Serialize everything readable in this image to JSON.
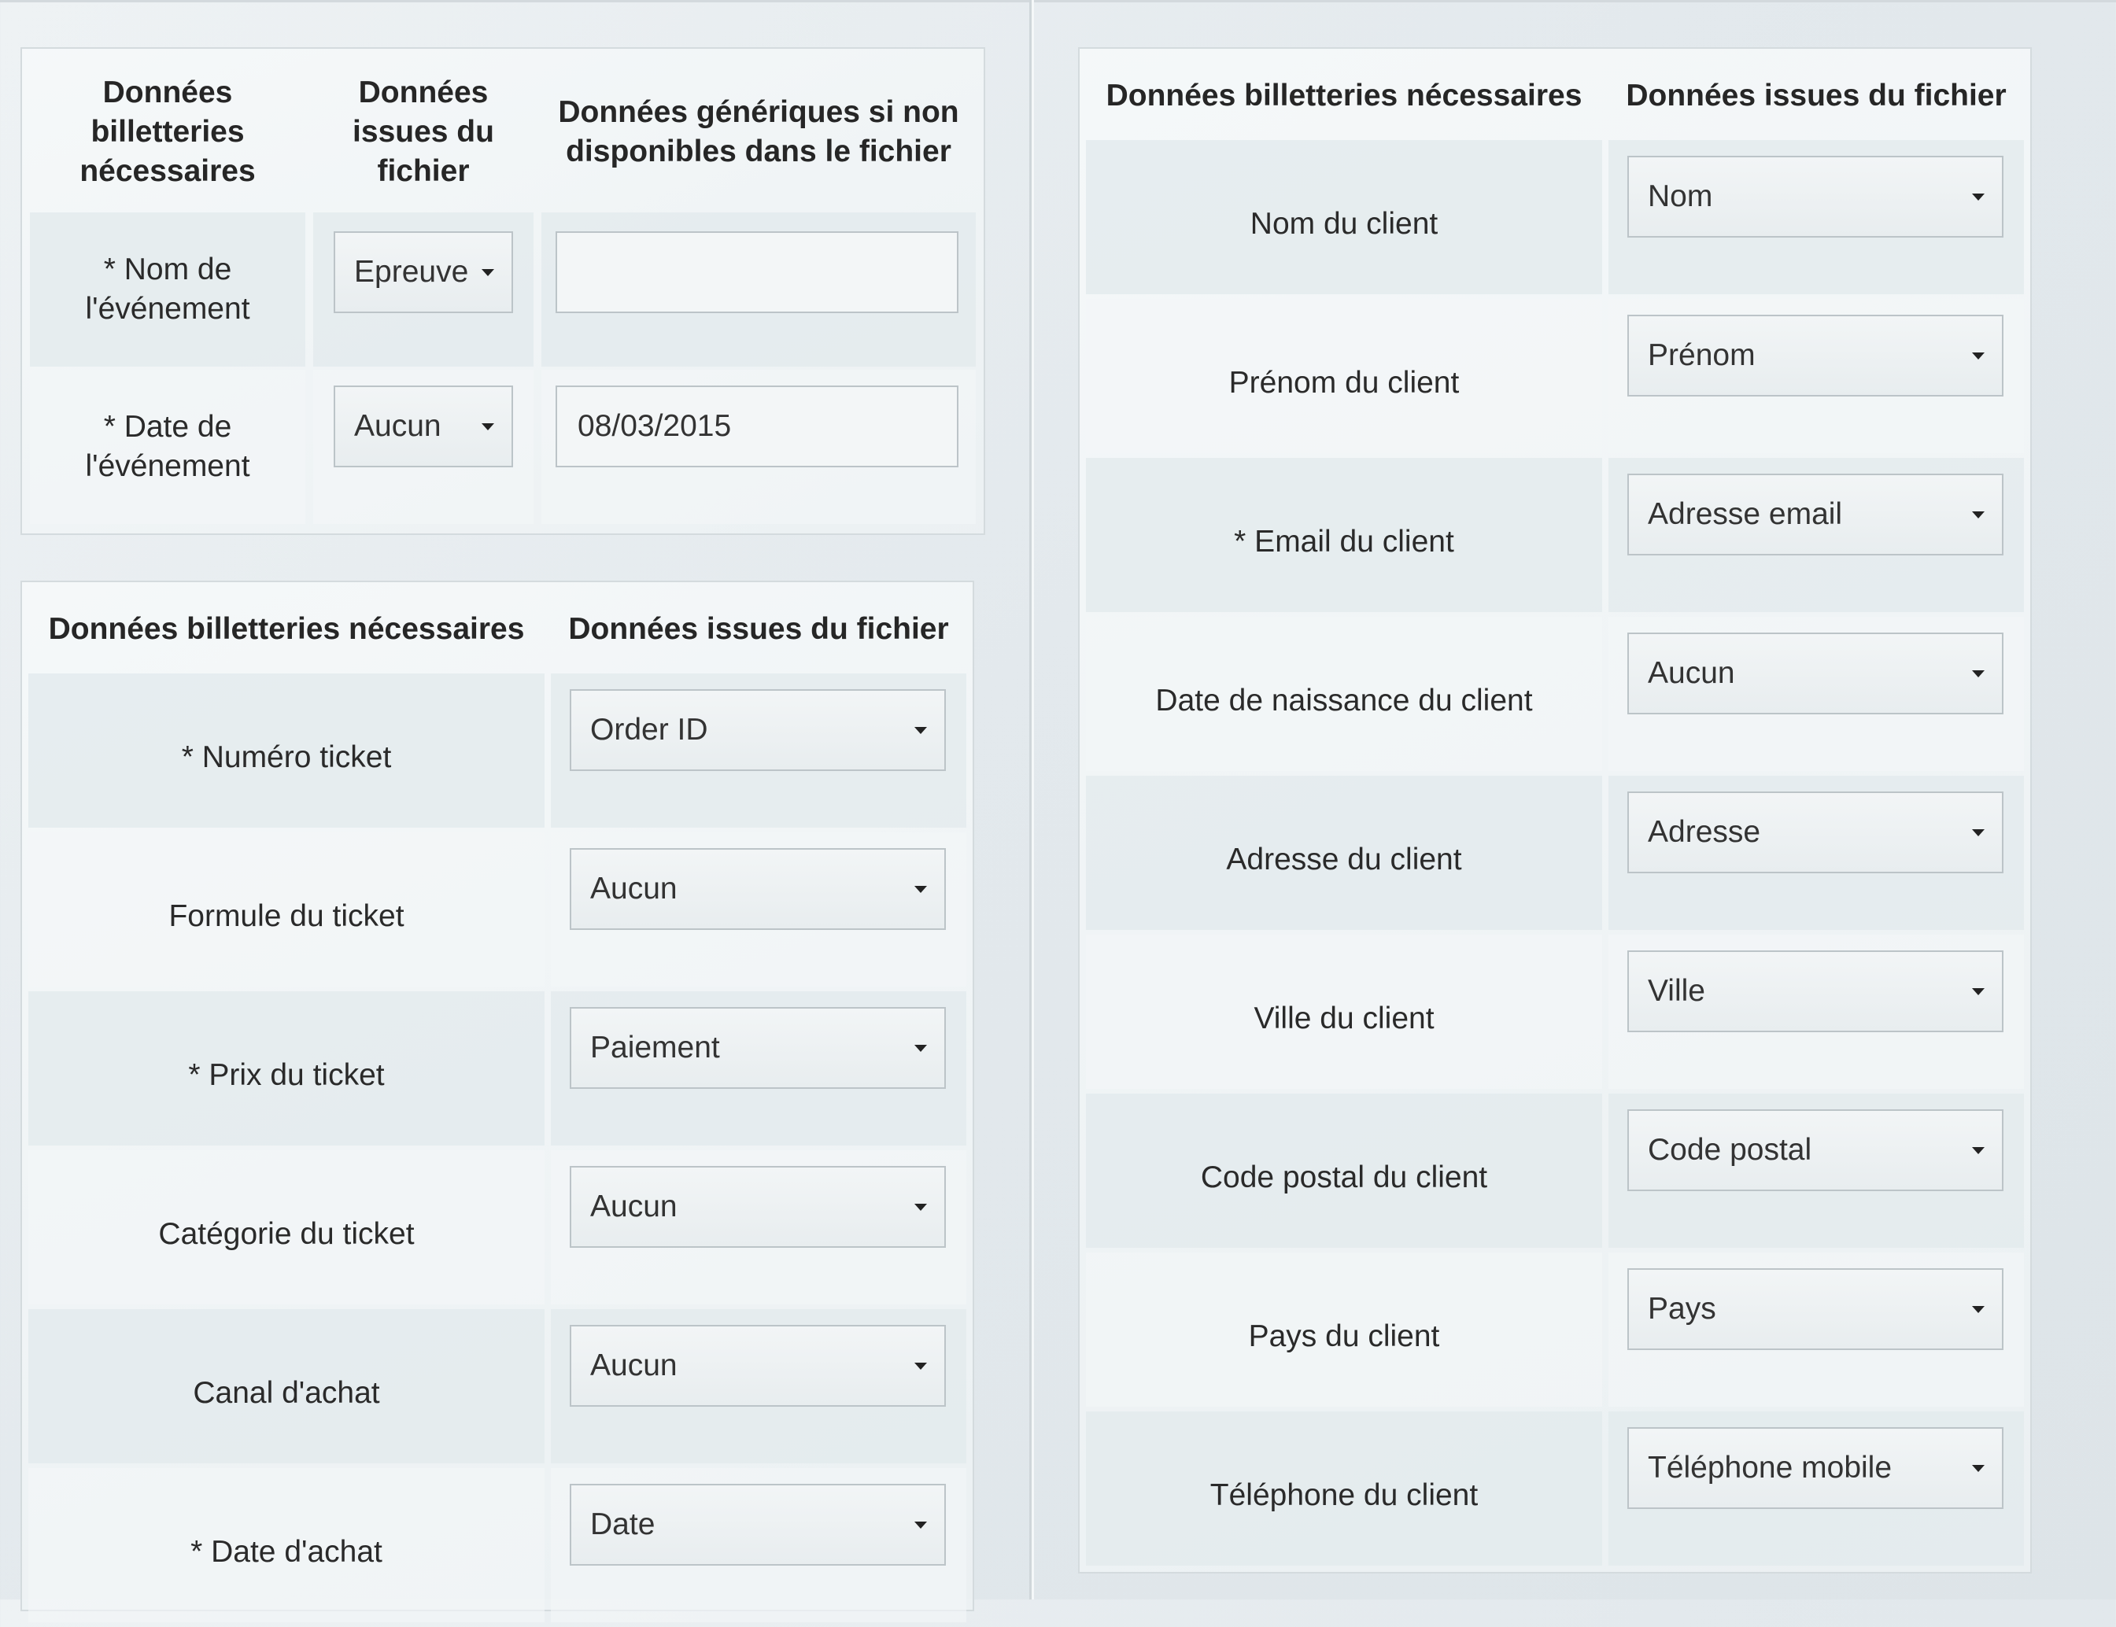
{
  "event_panel": {
    "headers": [
      "Données billetteries nécessaires",
      "Données issues du fichier",
      "Données génériques si non disponibles dans le fichier"
    ],
    "rows": [
      {
        "label": "* Nom de l'événement",
        "select": "Epreuve",
        "generic": "",
        "generic_placeholder": ""
      },
      {
        "label": "* Date de l'événement",
        "select": "Aucun",
        "generic": "08/03/2015",
        "generic_placeholder": ""
      }
    ]
  },
  "ticket_panel": {
    "headers": [
      "Données billetteries nécessaires",
      "Données issues du fichier"
    ],
    "rows": [
      {
        "label": "* Numéro ticket",
        "select": "Order ID"
      },
      {
        "label": "Formule du ticket",
        "select": "Aucun"
      },
      {
        "label": "* Prix du ticket",
        "select": "Paiement"
      },
      {
        "label": "Catégorie du ticket",
        "select": "Aucun"
      },
      {
        "label": "Canal d'achat",
        "select": "Aucun"
      },
      {
        "label": "* Date d'achat",
        "select": "Date"
      }
    ]
  },
  "client_panel": {
    "headers": [
      "Données billetteries nécessaires",
      "Données issues du fichier"
    ],
    "rows": [
      {
        "label": "Nom du client",
        "select": "Nom"
      },
      {
        "label": "Prénom du client",
        "select": "Prénom"
      },
      {
        "label": "* Email du client",
        "select": "Adresse email"
      },
      {
        "label": "Date de naissance du client",
        "select": "Aucun"
      },
      {
        "label": "Adresse du client",
        "select": "Adresse"
      },
      {
        "label": "Ville du client",
        "select": "Ville"
      },
      {
        "label": "Code postal du client",
        "select": "Code postal"
      },
      {
        "label": "Pays du client",
        "select": "Pays"
      },
      {
        "label": "Téléphone du client",
        "select": "Téléphone mobile"
      }
    ]
  },
  "icons": {
    "dropdown": "caret-down-icon"
  }
}
